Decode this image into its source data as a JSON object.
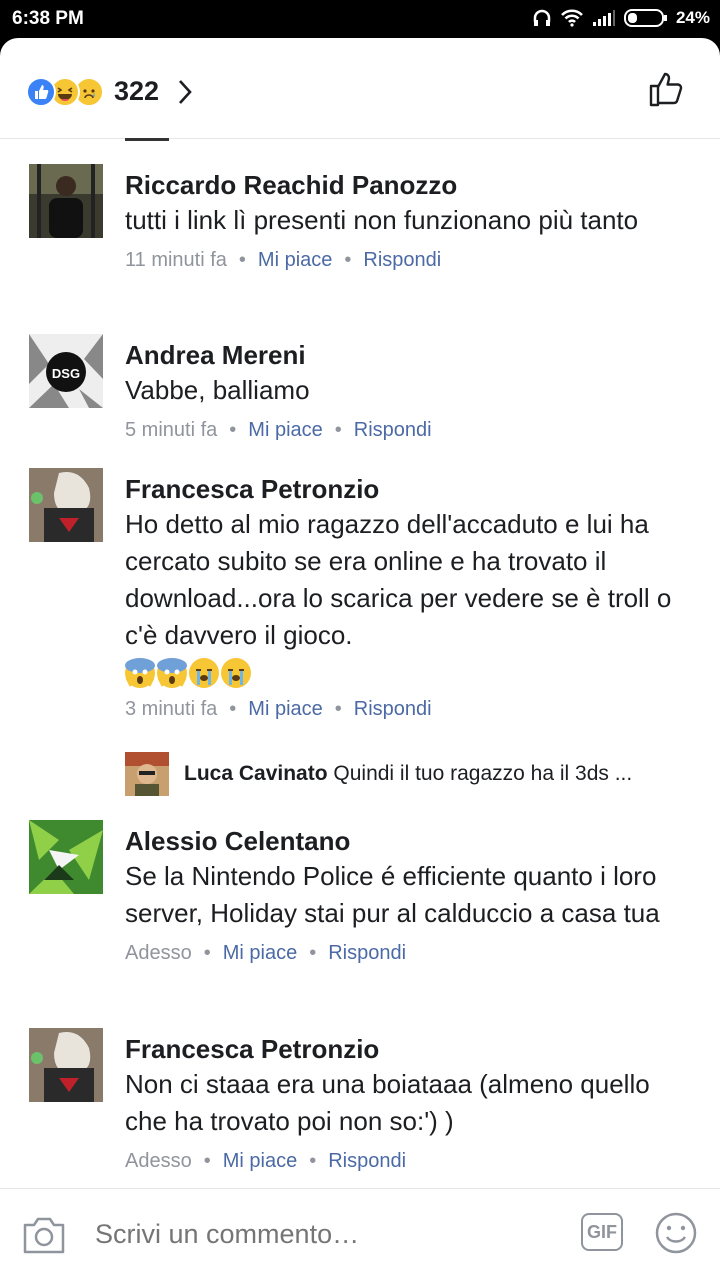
{
  "status_bar": {
    "time": "6:38 PM",
    "battery": "24%"
  },
  "header": {
    "reaction_count": "322",
    "reactions": [
      "like-icon",
      "haha-icon",
      "sad-icon"
    ]
  },
  "comments": [
    {
      "name": "Riccardo Reachid Panozzo",
      "text": "tutti i link lì presenti non funzionano più tanto",
      "time": "11 minuti fa",
      "like": "Mi piace",
      "reply": "Rispondi"
    },
    {
      "name": "Andrea Mereni",
      "text": "Vabbe, balliamo",
      "time": "5 minuti fa",
      "like": "Mi piace",
      "reply": "Rispondi"
    },
    {
      "name": "Francesca Petronzio",
      "text": "Ho detto al mio ragazzo dell'accaduto e lui ha cercato subito se era online e ha trovato il download...ora lo scarica per vedere se è troll o c'è davvero il gioco.",
      "time": "3 minuti fa",
      "like": "Mi piace",
      "reply": "Rispondi",
      "emojis": [
        "scream-emoji",
        "scream-emoji",
        "sob-emoji",
        "sob-emoji"
      ]
    },
    {
      "name": "Alessio Celentano",
      "text": "Se la Nintendo Police é efficiente quanto i loro server, Holiday stai pur al calduccio a casa tua",
      "time": "Adesso",
      "like": "Mi piace",
      "reply": "Rispondi"
    },
    {
      "name": "Francesca Petronzio",
      "text": "Non ci staaa era una boiataaa (almeno quello che ha trovato poi non so:') )",
      "time": "Adesso",
      "like": "Mi piace",
      "reply": "Rispondi"
    }
  ],
  "reply_preview": {
    "name": "Luca Cavinato",
    "text": "Quindi il tuo ragazzo ha il 3ds ..."
  },
  "composer": {
    "placeholder": "Scrivi un commento…",
    "gif_label": "GIF"
  },
  "colors": {
    "link": "#4b6aa5",
    "meta": "#90949c",
    "like_blue": "#3b82f6"
  }
}
